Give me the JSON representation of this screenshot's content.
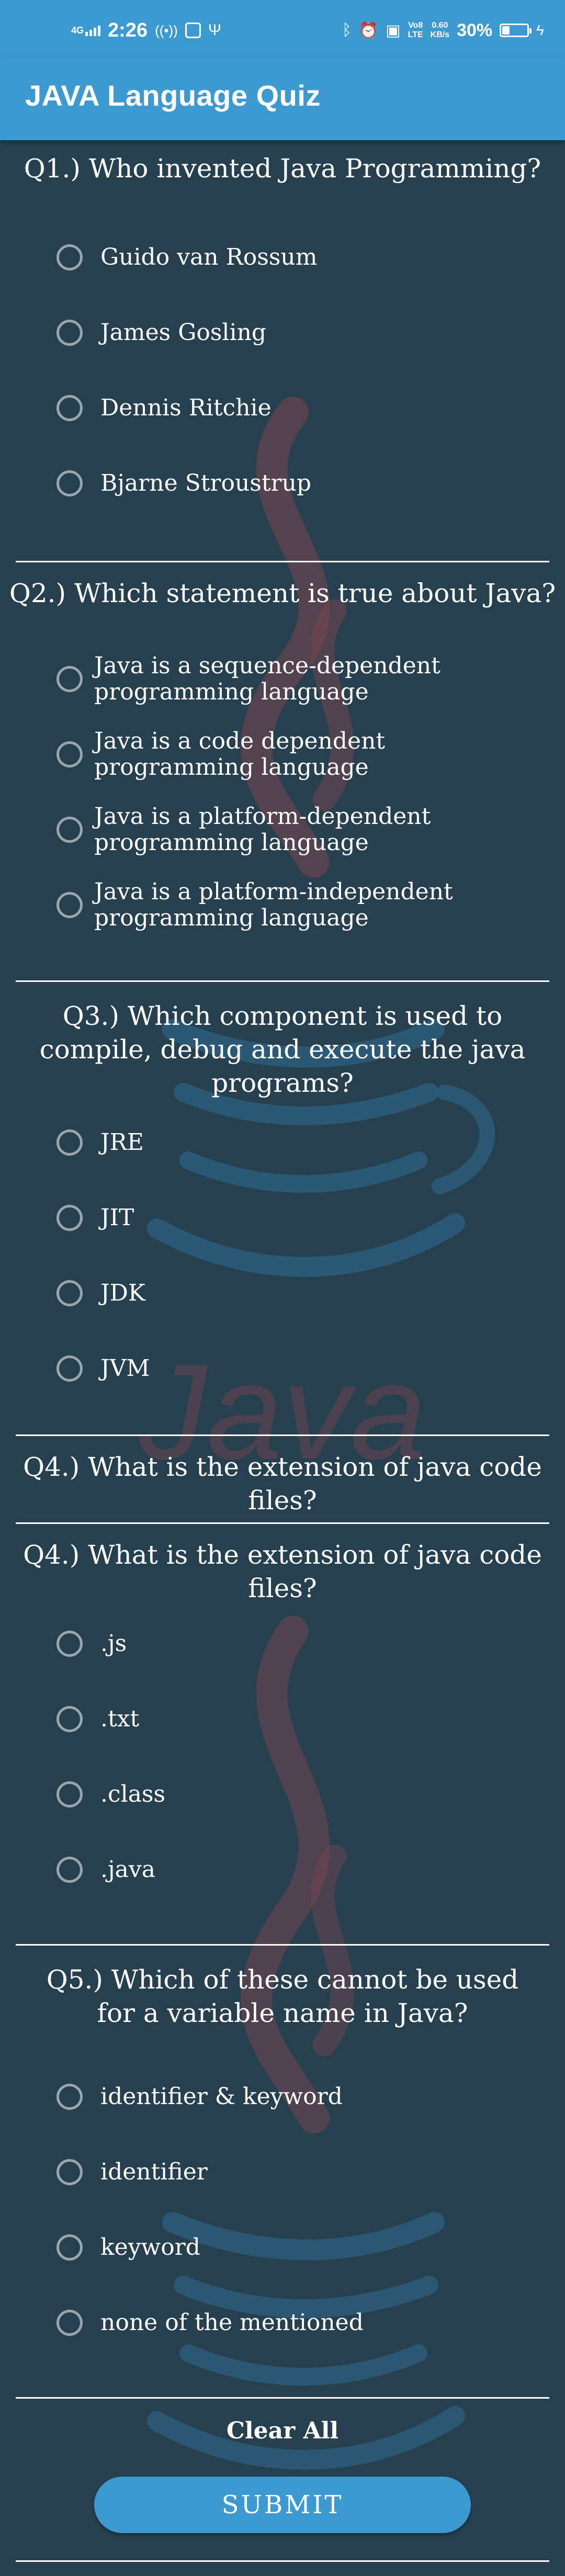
{
  "status_bar": {
    "network": "4G",
    "time": "2:26",
    "volte": "Vo8",
    "lte": "LTE",
    "net_speed_value": "0.60",
    "net_speed_unit": "KB/s",
    "battery": "30%"
  },
  "app_bar": {
    "title": "JAVA Language Quiz"
  },
  "questions": [
    {
      "text": "Q1.) Who invented Java Programming?",
      "options": [
        "Guido van Rossum",
        "James Gosling",
        "Dennis Ritchie",
        "Bjarne Stroustrup"
      ]
    },
    {
      "text": "Q2.) Which statement is true about Java?",
      "options": [
        "Java is a sequence-dependent programming language",
        "Java is a code dependent programming language",
        "Java is a platform-dependent programming language",
        "Java is a platform-independent programming language"
      ]
    },
    {
      "text": "Q3.) Which component is used to compile, debug and execute the java programs?",
      "options": [
        "JRE",
        "JIT",
        "JDK",
        "JVM"
      ]
    },
    {
      "text": "Q4.) What is the extension of java code files?",
      "options": []
    },
    {
      "text": "Q4.) What is the extension of java code files?",
      "options": [
        ".js",
        ".txt",
        ".class",
        ".java"
      ]
    },
    {
      "text": "Q5.) Which of these cannot be used for a variable name in Java?",
      "options": [
        "identifier & keyword",
        "identifier",
        "keyword",
        "none of the mentioned"
      ]
    }
  ],
  "actions": {
    "clear_all": "Clear All",
    "submit": "SUBMIT"
  },
  "colors": {
    "primary": "#3d9ad1",
    "background": "#26404f",
    "radio_border": "#9aa6ae",
    "watermark_red": "#8a4a52",
    "watermark_blue": "#2f6a8f"
  }
}
